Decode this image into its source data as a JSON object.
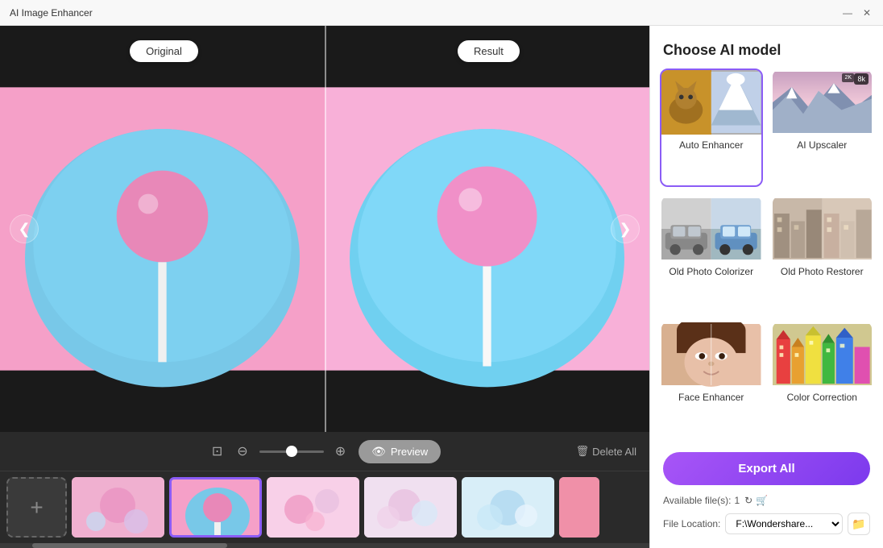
{
  "app": {
    "title": "AI Image Enhancer"
  },
  "titlebar": {
    "minimize_label": "—",
    "close_label": "✕"
  },
  "viewer": {
    "original_label": "Original",
    "result_label": "Result",
    "nav_left": "❮",
    "nav_right": "❯"
  },
  "toolbar": {
    "preview_label": "Preview",
    "delete_all_label": "Delete All",
    "zoom_value": 50
  },
  "thumbnail_strip": {
    "add_label": "+"
  },
  "right_panel": {
    "title": "Choose AI model",
    "models": [
      {
        "id": "auto-enhancer",
        "label": "Auto Enhancer",
        "selected": true
      },
      {
        "id": "ai-upscaler",
        "label": "AI Upscaler",
        "selected": false,
        "badge": "8k"
      },
      {
        "id": "old-photo-colorizer",
        "label": "Old Photo Colorizer",
        "selected": false
      },
      {
        "id": "old-photo-restorer",
        "label": "Old Photo Restorer",
        "selected": false
      },
      {
        "id": "face-enhancer",
        "label": "Face Enhancer",
        "selected": false
      },
      {
        "id": "color-correction",
        "label": "Color Correction",
        "selected": false
      }
    ],
    "export_label": "Export All",
    "available_files_label": "Available file(s):",
    "available_files_count": "1",
    "file_location_label": "File Location:",
    "file_location_value": "F:\\Wondershare..."
  }
}
